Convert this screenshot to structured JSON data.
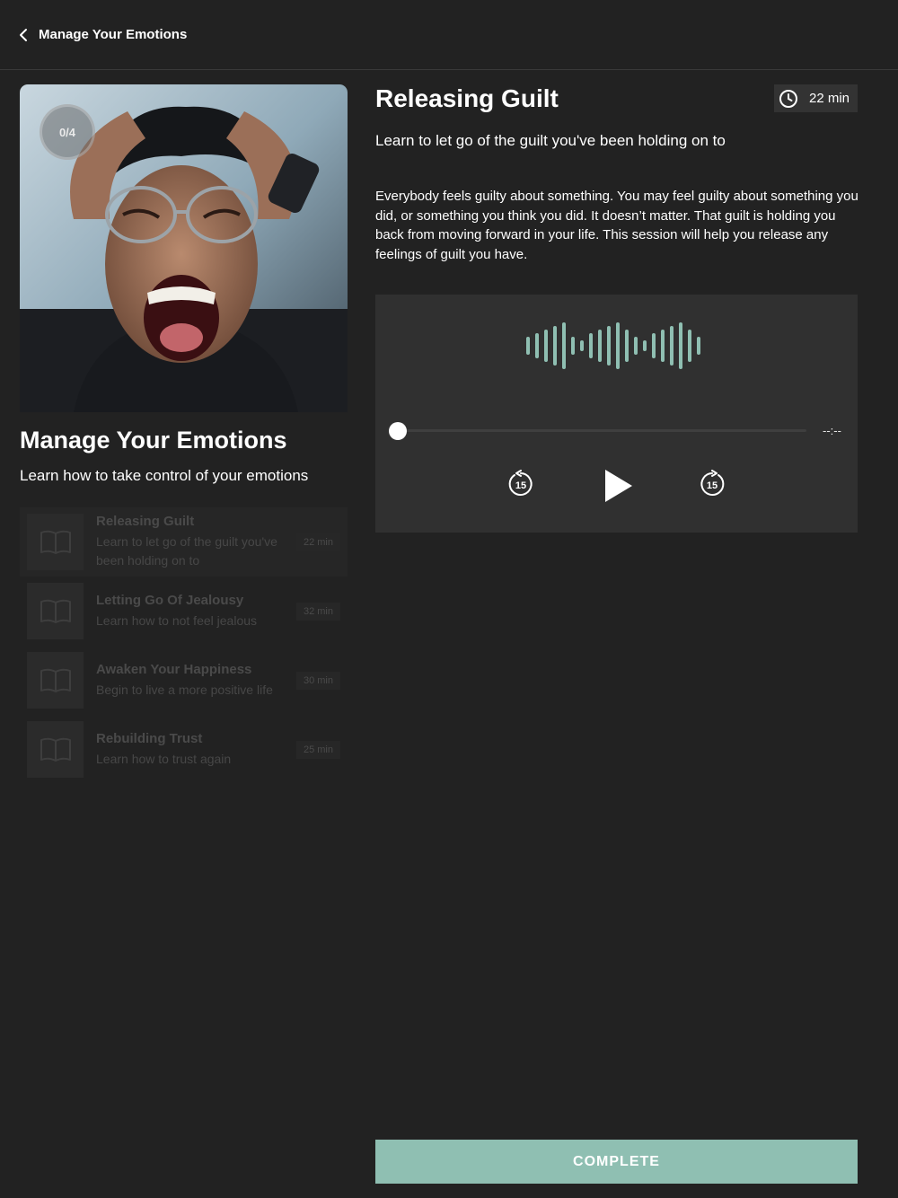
{
  "header": {
    "back_label": "Manage Your Emotions"
  },
  "course": {
    "progress": "0/4",
    "title": "Manage Your Emotions",
    "subtitle": "Learn how to take control of your emotions",
    "lessons": [
      {
        "name": "Releasing Guilt",
        "desc": "Learn to let go of the guilt you've been holding on to",
        "duration": "22 min"
      },
      {
        "name": "Letting Go Of Jealousy",
        "desc": "Learn how to not feel jealous",
        "duration": "32 min"
      },
      {
        "name": "Awaken Your Happiness",
        "desc": "Begin to live a more positive life",
        "duration": "30 min"
      },
      {
        "name": "Rebuilding Trust",
        "desc": "Learn how to trust again",
        "duration": "25 min"
      }
    ]
  },
  "session": {
    "title": "Releasing Guilt",
    "duration": "22 min",
    "subtitle": "Learn to let go of the guilt you've been holding on to",
    "description": "Everybody feels guilty about something. You may feel guilty about something you did, or something you think you did. It doesn’t matter. That guilt is holding you back from moving forward in your life. This session will help you release any feelings of guilt you have."
  },
  "player": {
    "time": "--:--",
    "rewind_seconds": "15",
    "forward_seconds": "15",
    "progress": 0,
    "waveform_color": "#8fbfb2"
  },
  "actions": {
    "complete_label": "COMPLETE"
  },
  "colors": {
    "accent": "#8fbfb2",
    "background": "#222222",
    "panel": "#303030"
  }
}
